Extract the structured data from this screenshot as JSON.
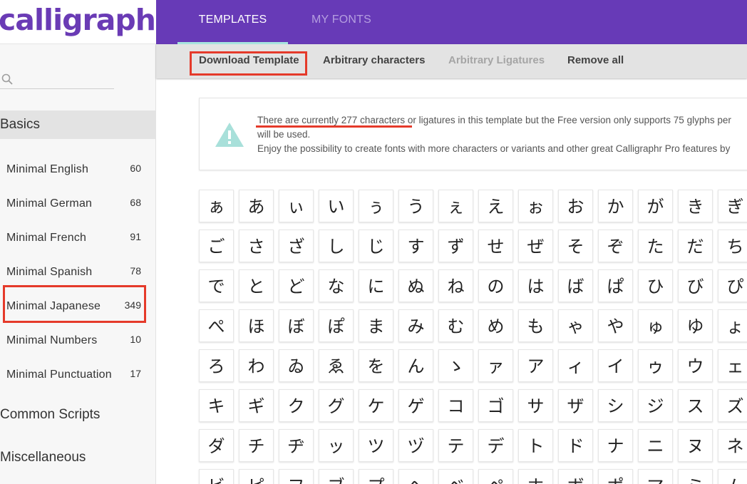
{
  "app": {
    "logo": "calligraphr"
  },
  "nav": {
    "tabs": [
      {
        "label": "TEMPLATES",
        "active": true
      },
      {
        "label": "MY FONTS",
        "active": false
      }
    ]
  },
  "toolbar": {
    "download_label": "Download Template",
    "arbitrary_chars_label": "Arbitrary characters",
    "arbitrary_ligatures_label": "Arbitrary Ligatures",
    "remove_all_label": "Remove all"
  },
  "sidebar": {
    "search_placeholder": "",
    "basics_label": "Basics",
    "items": [
      {
        "label": "Minimal English",
        "count": "60"
      },
      {
        "label": "Minimal German",
        "count": "68"
      },
      {
        "label": "Minimal French",
        "count": "91"
      },
      {
        "label": "Minimal Spanish",
        "count": "78"
      },
      {
        "label": "Minimal Japanese",
        "count": "349"
      },
      {
        "label": "Minimal Numbers",
        "count": "10"
      },
      {
        "label": "Minimal Punctuation",
        "count": "17"
      }
    ],
    "common_scripts_label": "Common Scripts",
    "miscellaneous_label": "Miscellaneous"
  },
  "notice": {
    "line1_part1": "There are currently 277 characters",
    "line1_part2": " or ligatures in this template but the Free version only supports 75 glyphs per",
    "line2": "will be used.",
    "line3": "Enjoy the possibility to create fonts with more characters or variants and other great Calligraphr Pro features by"
  },
  "glyphs": [
    [
      "ぁ",
      "あ",
      "ぃ",
      "い",
      "ぅ",
      "う",
      "ぇ",
      "え",
      "ぉ",
      "お",
      "か",
      "が",
      "き",
      "ぎ"
    ],
    [
      "ご",
      "さ",
      "ざ",
      "し",
      "じ",
      "す",
      "ず",
      "せ",
      "ぜ",
      "そ",
      "ぞ",
      "た",
      "だ",
      "ち"
    ],
    [
      "で",
      "と",
      "ど",
      "な",
      "に",
      "ぬ",
      "ね",
      "の",
      "は",
      "ば",
      "ぱ",
      "ひ",
      "び",
      "ぴ"
    ],
    [
      "ぺ",
      "ほ",
      "ぼ",
      "ぽ",
      "ま",
      "み",
      "む",
      "め",
      "も",
      "ゃ",
      "や",
      "ゅ",
      "ゆ",
      "ょ"
    ],
    [
      "ろ",
      "わ",
      "ゐ",
      "ゑ",
      "を",
      "ん",
      "ゝ",
      "ァ",
      "ア",
      "ィ",
      "イ",
      "ゥ",
      "ウ",
      "ェ"
    ],
    [
      "キ",
      "ギ",
      "ク",
      "グ",
      "ケ",
      "ゲ",
      "コ",
      "ゴ",
      "サ",
      "ザ",
      "シ",
      "ジ",
      "ス",
      "ズ"
    ],
    [
      "ダ",
      "チ",
      "ヂ",
      "ッ",
      "ツ",
      "ヅ",
      "テ",
      "デ",
      "ト",
      "ド",
      "ナ",
      "ニ",
      "ヌ",
      "ネ"
    ],
    [
      "ビ",
      "ピ",
      "フ",
      "ブ",
      "プ",
      "ヘ",
      "ベ",
      "ペ",
      "ホ",
      "ボ",
      "ポ",
      "マ",
      "ミ",
      "ム"
    ]
  ],
  "colors": {
    "brand": "#673ab7",
    "accent": "#a8e6e0",
    "highlight": "#e53a2a",
    "warning_icon": "#a8e0da"
  }
}
